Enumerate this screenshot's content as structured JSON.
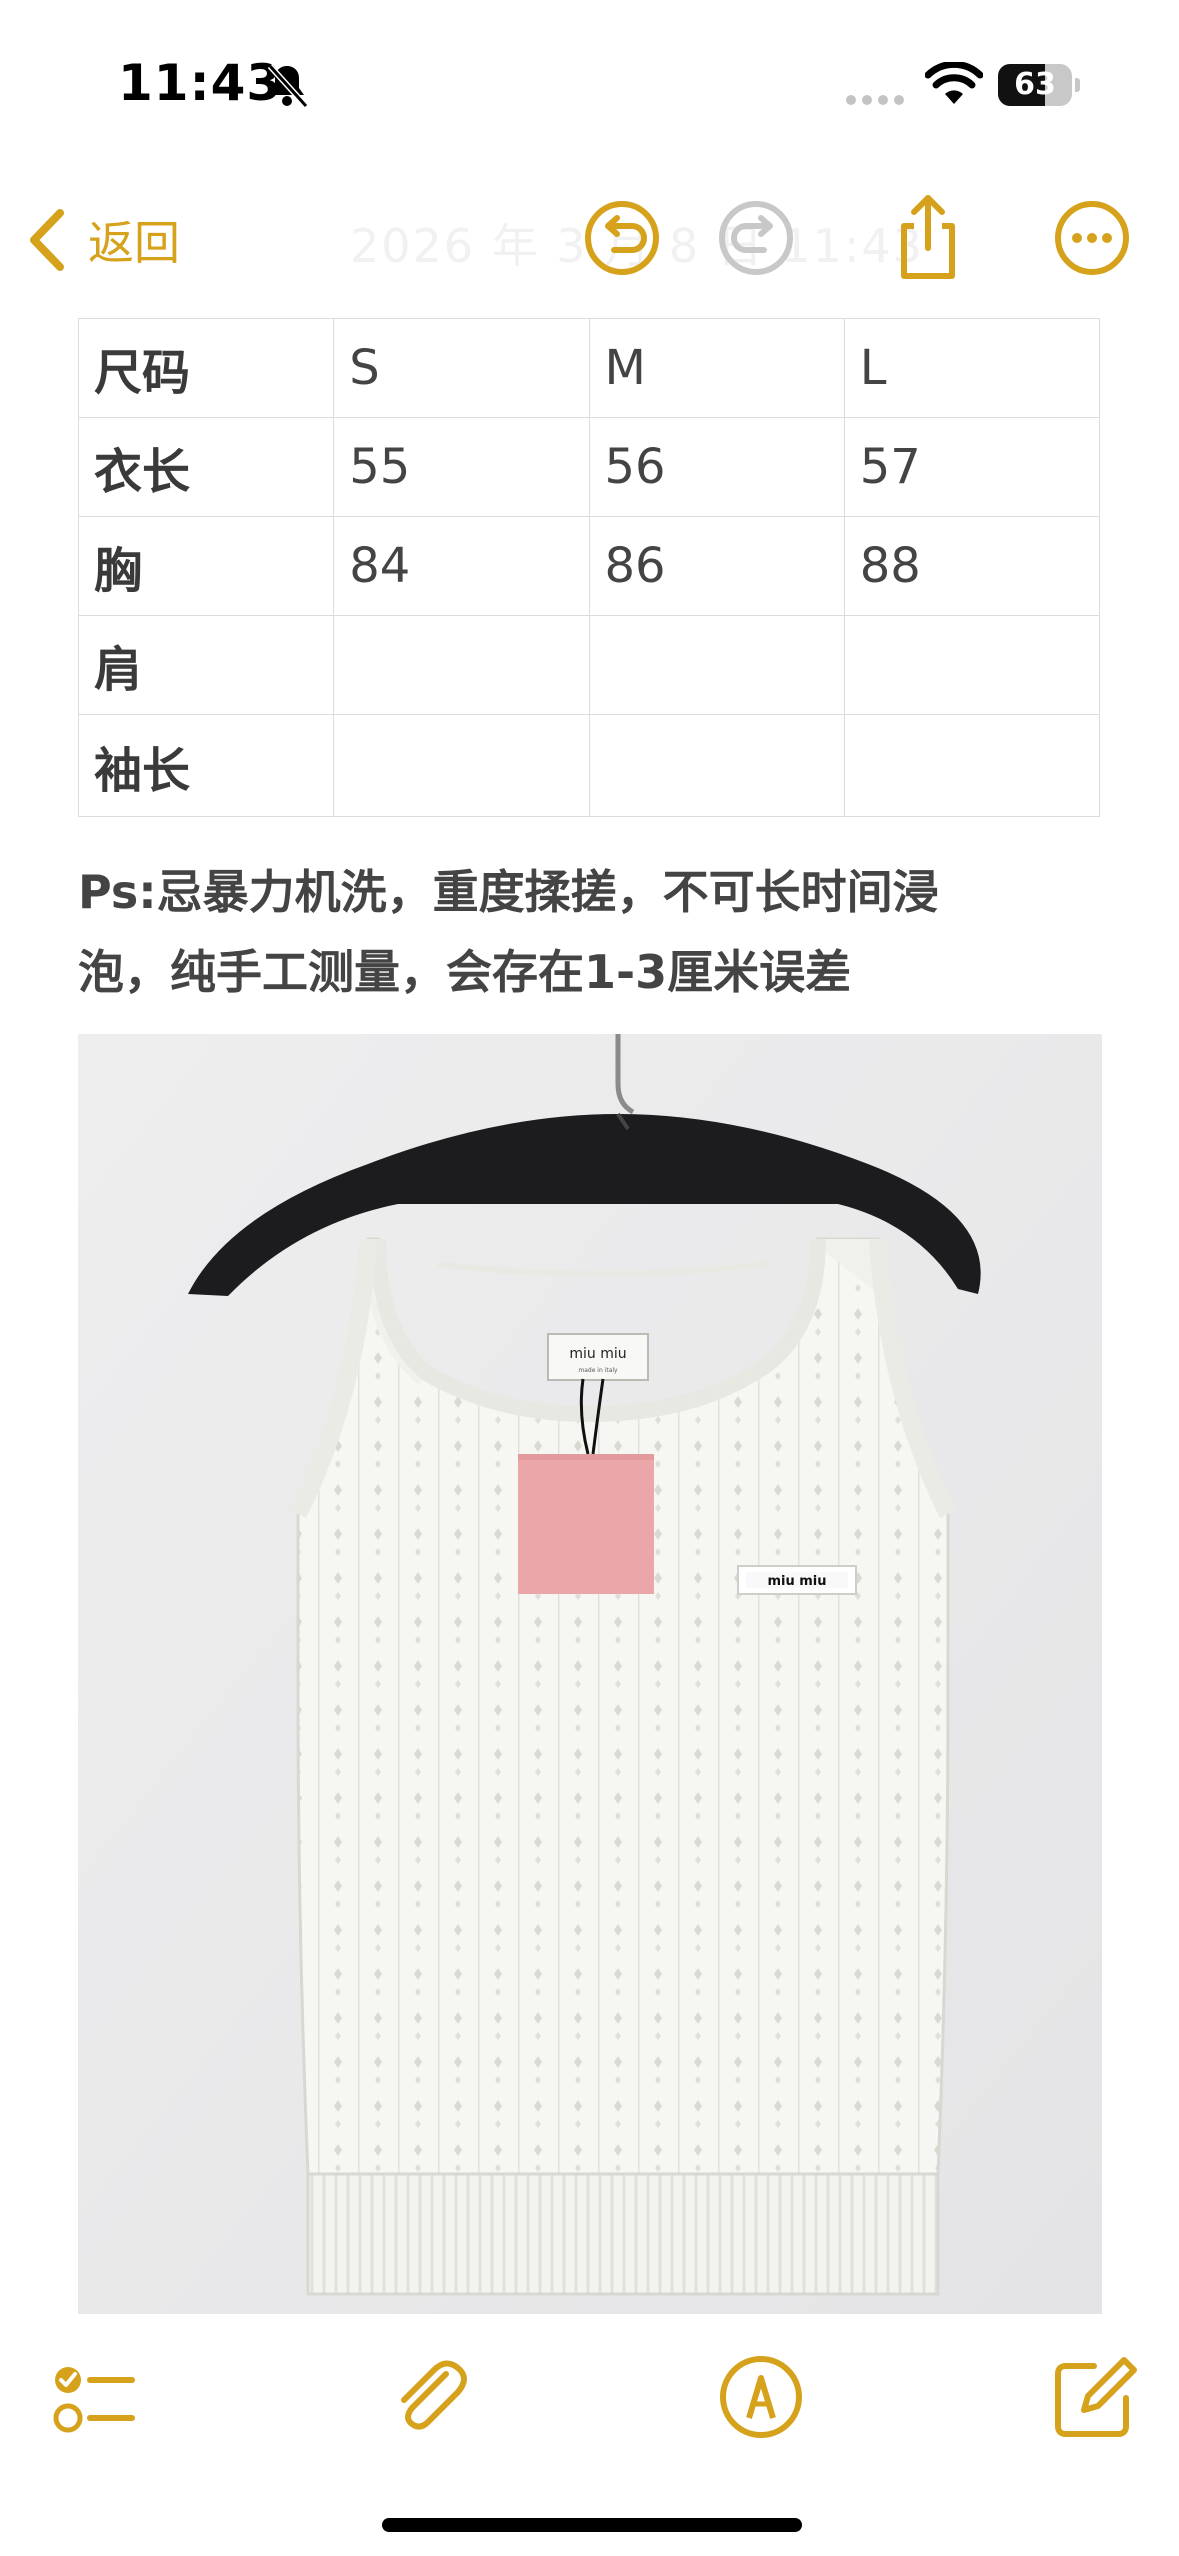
{
  "status_bar": {
    "time": "11:43",
    "battery_text": "63",
    "battery_level": 0.63,
    "icons": [
      "bell-slash-icon",
      "signal-dots-icon",
      "wifi-icon",
      "battery-icon"
    ]
  },
  "nav": {
    "back_label": "返回",
    "title_ghost": "2026 年 3 月 8 日 11:43",
    "icons": [
      "chevron-left-icon",
      "undo-icon",
      "redo-icon",
      "share-icon",
      "more-icon"
    ]
  },
  "size_table": {
    "header": [
      "尺码",
      "S",
      "M",
      "L"
    ],
    "rows": [
      [
        "衣长",
        "55",
        "56",
        "57"
      ],
      [
        "胸",
        "84",
        "86",
        "88"
      ],
      [
        "肩",
        "",
        "",
        ""
      ],
      [
        "袖长",
        "",
        "",
        ""
      ]
    ]
  },
  "note": {
    "line1": "Ps:忌暴力机洗，重度揉搓，不可长时间浸",
    "line2": "泡，纯手工测量，会存在1-3厘米误差"
  },
  "photo": {
    "tag_text": "miu miu",
    "label_text": "miu miu",
    "tag_subtext": "made in italy"
  },
  "toolbar": {
    "icons": [
      "checklist-icon",
      "paperclip-icon",
      "markup-icon",
      "compose-icon"
    ]
  },
  "colors": {
    "accent": "#d6a21b",
    "table_border": "#dcdcdc",
    "text": "#444444"
  }
}
